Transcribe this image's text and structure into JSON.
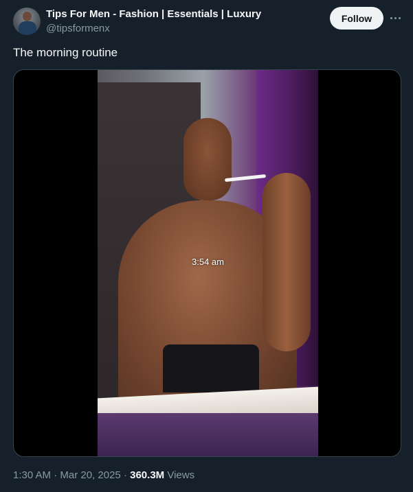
{
  "author": {
    "display_name": "Tips For Men - Fashion | Essentials | Luxury",
    "handle": "@tipsformenx",
    "avatar_icon": "profile-photo"
  },
  "actions": {
    "follow_label": "Follow",
    "more_icon": "more-horizontal-icon"
  },
  "tweet": {
    "text": "The morning routine"
  },
  "media": {
    "overlay_time": "3:54 am"
  },
  "meta": {
    "time": "1:30 AM",
    "separator1": " · ",
    "date": "Mar 20, 2025",
    "separator2": " · ",
    "views_count": "360.3M",
    "views_label": " Views"
  },
  "colors": {
    "background": "#15202b",
    "primary_text": "#f7f9f9",
    "secondary_text": "#8b98a5",
    "follow_bg": "#eff3f4"
  }
}
